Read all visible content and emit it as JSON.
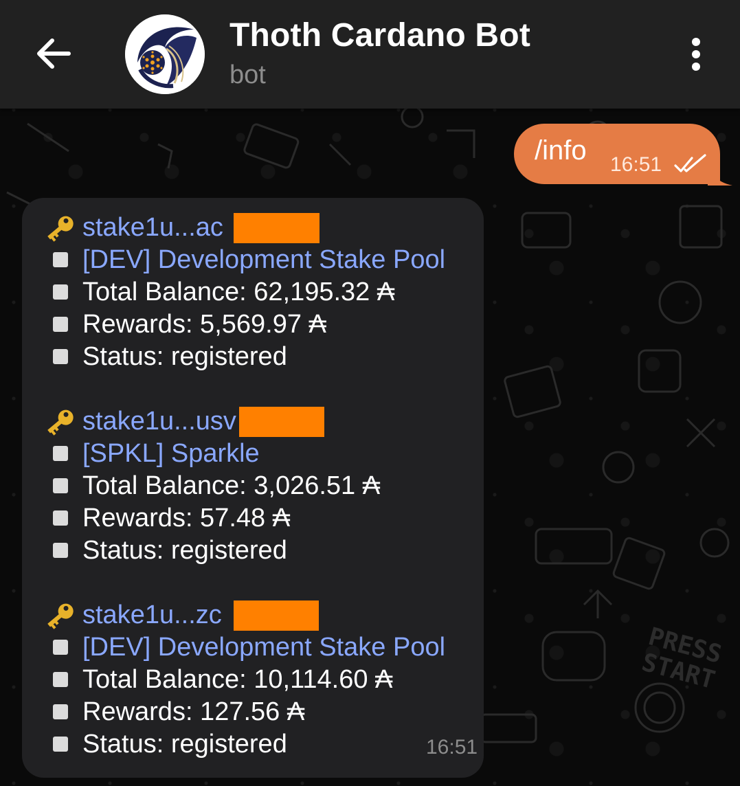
{
  "header": {
    "title": "Thoth Cardano Bot",
    "subtitle": "bot",
    "back_icon": "arrow-left-icon",
    "menu_icon": "more-vertical-icon"
  },
  "outgoing": {
    "text": "/info",
    "time": "16:51",
    "status_icon": "double-check-icon",
    "color": "#e57c45"
  },
  "incoming": {
    "time": "16:51",
    "accounts": [
      {
        "address": "stake1u...ac",
        "pool": "[DEV] Development Stake Pool",
        "total_balance": "Total Balance: 62,195.32 ₳",
        "rewards": "Rewards: 5,569.97 ₳",
        "status": "Status: registered"
      },
      {
        "address": "stake1u...usv",
        "pool": "[SPKL] Sparkle",
        "total_balance": "Total Balance: 3,026.51 ₳",
        "rewards": "Rewards: 57.48 ₳",
        "status": "Status: registered"
      },
      {
        "address": "stake1u...zc",
        "pool": "[DEV] Development Stake Pool",
        "total_balance": "Total Balance: 10,114.60 ₳",
        "rewards": "Rewards: 127.56 ₳",
        "status": "Status: registered"
      }
    ]
  },
  "colors": {
    "link": "#8aa8ff",
    "redaction": "#ff8000",
    "header_bg": "#212121",
    "bubble_bg": "#212123"
  }
}
